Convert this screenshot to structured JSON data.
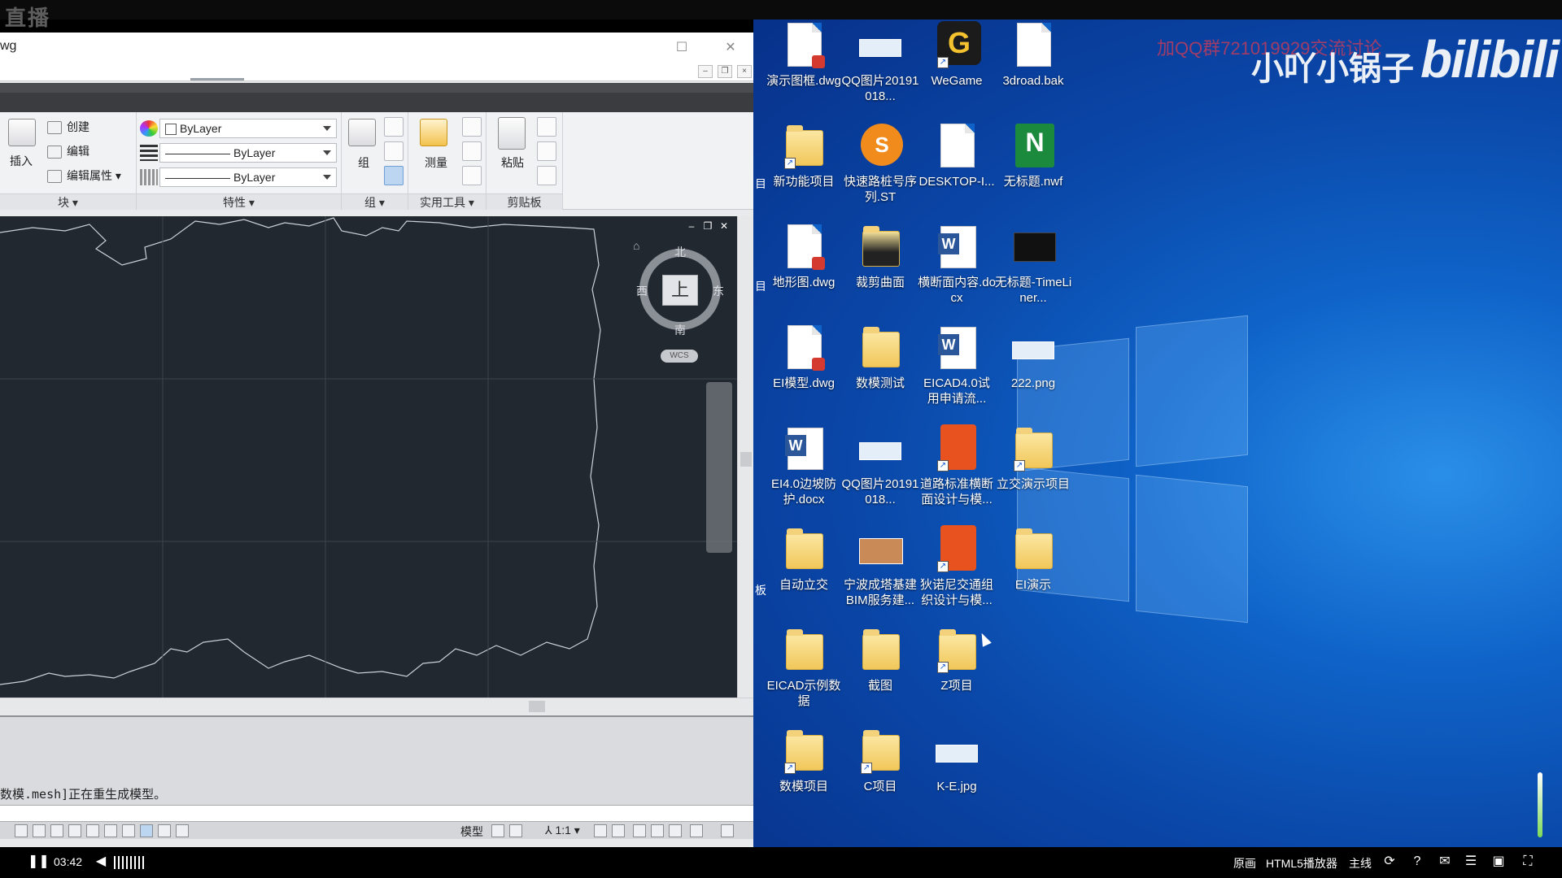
{
  "stream": {
    "logo_text": "直播"
  },
  "cad": {
    "window_title": "wg",
    "ribbon": {
      "block": {
        "insert": "插入",
        "create": "创建",
        "edit": "编辑",
        "edit_attr": "编辑属性",
        "title": "块"
      },
      "properties": {
        "color": "ByLayer",
        "linetype": "ByLayer",
        "lineweight": "ByLayer",
        "title": "特性"
      },
      "group": {
        "label": "组",
        "title": "组"
      },
      "utilities": {
        "measure": "测量",
        "title": "实用工具"
      },
      "clipboard": {
        "paste": "粘贴",
        "title": "剪贴板"
      }
    },
    "viewcube": {
      "north": "北",
      "south": "南",
      "east": "东",
      "west": "西",
      "face": "上",
      "wcs": "WCS"
    },
    "command_line": "数模.mesh]正在重生成模型。",
    "status": {
      "model": "模型",
      "scale": "1:1"
    }
  },
  "desktop": {
    "watermark": {
      "qq": "加QQ群721019929交流讨论",
      "channel": "小吖小锅子",
      "brand": "bilibili"
    },
    "icons": [
      {
        "label": "演示图框.dwg",
        "type": "dwg"
      },
      {
        "label": "QQ图片20191018...",
        "type": "image"
      },
      {
        "label": "WeGame",
        "type": "wegame"
      },
      {
        "label": "3droad.bak",
        "type": "file"
      },
      {
        "label": "新功能项目",
        "type": "folder-shortcut"
      },
      {
        "label": "快速路桩号序列.ST",
        "type": "orange"
      },
      {
        "label": "DESKTOP-I...",
        "type": "file"
      },
      {
        "label": "无标题.nwf",
        "type": "nwf"
      },
      {
        "label": "地形图.dwg",
        "type": "dwg"
      },
      {
        "label": "裁剪曲面",
        "type": "folder-dark"
      },
      {
        "label": "横断面内容.docx",
        "type": "word"
      },
      {
        "label": "无标题-TimeLiner...",
        "type": "black"
      },
      {
        "label": "EI模型.dwg",
        "type": "dwg"
      },
      {
        "label": "数模测试",
        "type": "folder"
      },
      {
        "label": "EICAD4.0试用申请流...",
        "type": "word"
      },
      {
        "label": "222.png",
        "type": "image"
      },
      {
        "label": "EI4.0边坡防护.docx",
        "type": "word"
      },
      {
        "label": "QQ图片20191018...",
        "type": "image"
      },
      {
        "label": "道路标准横断面设计与模...",
        "type": "road"
      },
      {
        "label": "立交演示项目",
        "type": "folder-shortcut"
      },
      {
        "label": "自动立交",
        "type": "folder"
      },
      {
        "label": "宁波成塔基建BIM服务建...",
        "type": "ppt"
      },
      {
        "label": "狄诺尼交通组织设计与模...",
        "type": "road"
      },
      {
        "label": "EI演示",
        "type": "folder"
      },
      {
        "label": "EICAD示例数据",
        "type": "folder"
      },
      {
        "label": "截图",
        "type": "folder"
      },
      {
        "label": "Z项目",
        "type": "folder-shortcut"
      },
      {
        "label": "",
        "type": "none"
      },
      {
        "label": "数模项目",
        "type": "folder-shortcut"
      },
      {
        "label": "C项目",
        "type": "folder-shortcut"
      },
      {
        "label": "K-E.jpg",
        "type": "image"
      }
    ],
    "left_edge_chars": [
      "目",
      "目",
      "板"
    ]
  },
  "player": {
    "time": "03:42",
    "original": "原画",
    "html5": "HTML5播放器",
    "line": "主线"
  }
}
